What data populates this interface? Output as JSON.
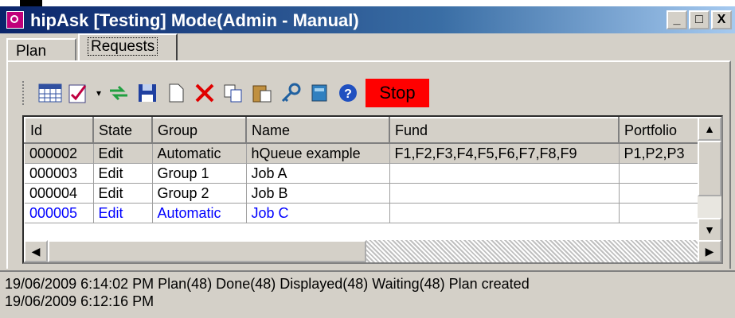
{
  "window": {
    "title": "hipAsk [Testing] Mode(Admin - Manual)",
    "controls": [
      "_",
      "□",
      "X"
    ]
  },
  "tabs": [
    {
      "label": "Plan",
      "active": false
    },
    {
      "label": "Requests",
      "active": true
    }
  ],
  "toolbar": {
    "icons": [
      "calendar-grid-icon",
      "checklist-icon",
      "dropdown-arrow-icon",
      "refresh-arrows-icon",
      "save-disk-icon",
      "new-document-icon",
      "delete-x-icon",
      "copy-icon",
      "paste-icon",
      "key-icon",
      "book-icon",
      "help-icon"
    ],
    "stop_label": "Stop",
    "stop_color": "#ff0000"
  },
  "grid": {
    "columns": [
      "Id",
      "State",
      "Group",
      "Name",
      "Fund",
      "Portfolio"
    ],
    "rows": [
      {
        "id": "000002",
        "state": "Edit",
        "group": "Automatic",
        "name": "hQueue example",
        "fund": "F1,F2,F3,F4,F5,F6,F7,F8,F9",
        "portfolio": "P1,P2,P3"
      },
      {
        "id": "000003",
        "state": "Edit",
        "group": "Group 1",
        "name": "Job A",
        "fund": "",
        "portfolio": ""
      },
      {
        "id": "000004",
        "state": "Edit",
        "group": "Group 2",
        "name": "Job B",
        "fund": "",
        "portfolio": ""
      },
      {
        "id": "000005",
        "state": "Edit",
        "group": "Automatic",
        "name": "Job C",
        "fund": "",
        "portfolio": ""
      }
    ]
  },
  "status": {
    "line1": "19/06/2009 6:14:02 PM Plan(48) Done(48) Displayed(48) Waiting(48) Plan created",
    "line2": "19/06/2009 6:12:16 PM"
  }
}
